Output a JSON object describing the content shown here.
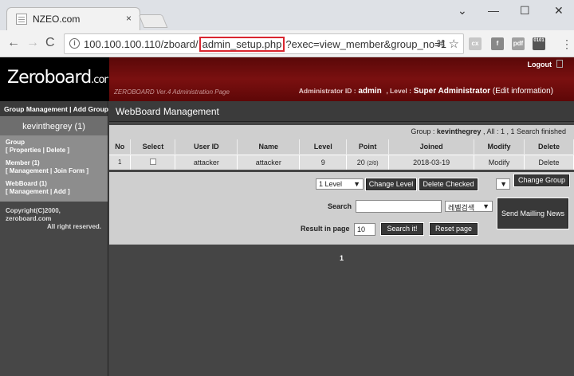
{
  "browser": {
    "tab_title": "NZEO.com",
    "tab_close": "×",
    "window_controls": [
      "⌄",
      "—",
      "☐",
      "✕"
    ],
    "url_prefix": "100.100.100.110/zboard/",
    "url_highlight": "admin_setup.php",
    "url_suffix": "?exec=view_member&group_no=1",
    "nav": {
      "back": "←",
      "forward": "→",
      "reload": "C"
    },
    "ext_icons": [
      "cx",
      "f",
      "pdf",
      "0101"
    ]
  },
  "header": {
    "logo_main": "Zeroboard",
    "logo_suffix": ".com",
    "logout": "Logout",
    "version": "ZEROBOARD Ver.4 Administration Page",
    "admin_id_label": "Administrator ID :",
    "admin_id": "admin",
    "level_label": ", Level :",
    "level_value": "Super Administrator",
    "edit_info": "(Edit information)"
  },
  "sidebar": {
    "top_links": [
      "Group Management",
      "Add Group"
    ],
    "user": "kevinthegrey (1)",
    "group_label": "Group",
    "group_links": "[ Properties | Delete ]",
    "member_label": "Member",
    "member_count": "(1)",
    "member_links": "[ Management | Join Form ]",
    "webboard_label": "WebBoard",
    "webboard_count": "(1)",
    "webboard_links": "[ Management | Add ]",
    "copyright_1": "Copyright(C)2000, zeroboard.com",
    "copyright_2": "All right reserved."
  },
  "main": {
    "title": "WebBoard Management",
    "summary_prefix": "Group :",
    "summary_group": "kevinthegrey",
    "summary_suffix": ", All : 1 , 1 Search finished",
    "columns": [
      "No",
      "Select",
      "User ID",
      "Name",
      "Level",
      "Point",
      "Joined",
      "Modify",
      "Delete"
    ],
    "row": {
      "no": "1",
      "user_id": "attacker",
      "name": "attacker",
      "level": "9",
      "point": "20",
      "point_detail": "(2/0)",
      "joined": "2018-03-19",
      "modify": "Modify",
      "delete": "Delete"
    },
    "level_select": "1 Level",
    "change_level": "Change Level",
    "delete_checked": "Delete Checked",
    "group_select": "",
    "change_group": "Change Group",
    "search_label": "Search",
    "search_value": "",
    "search_type": "레벨검색",
    "send_mail": "Send Mailling News",
    "result_label": "Result in page",
    "result_value": "10",
    "search_button": "Search it!",
    "reset_button": "Reset page",
    "page_number": "1"
  }
}
